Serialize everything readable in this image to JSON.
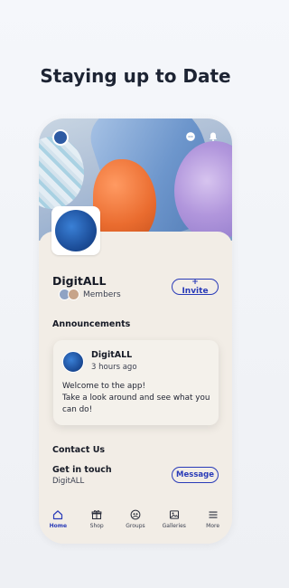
{
  "headline": "Staying up to Date",
  "group": {
    "name": "DigitALL",
    "members_label": "Members",
    "invite_label": "+ Invite"
  },
  "announcements": {
    "title": "Announcements",
    "post": {
      "author": "DigitALL",
      "time": "3 hours ago",
      "lines": [
        "Welcome to the app!",
        "Take a look around and see what you",
        "can do!"
      ]
    }
  },
  "contact": {
    "title": "Contact Us",
    "label": "Get in touch",
    "sub": "DigitALL",
    "message_label": "Message"
  },
  "nav": [
    {
      "label": "Home",
      "icon": "home-icon",
      "active": true
    },
    {
      "label": "Shop",
      "icon": "gift-icon",
      "active": false
    },
    {
      "label": "Groups",
      "icon": "groups-icon",
      "active": false
    },
    {
      "label": "Galleries",
      "icon": "image-icon",
      "active": false
    },
    {
      "label": "More",
      "icon": "menu-icon",
      "active": false
    }
  ],
  "colors": {
    "accent": "#2a3bb8",
    "sheet": "#f2ede6"
  }
}
